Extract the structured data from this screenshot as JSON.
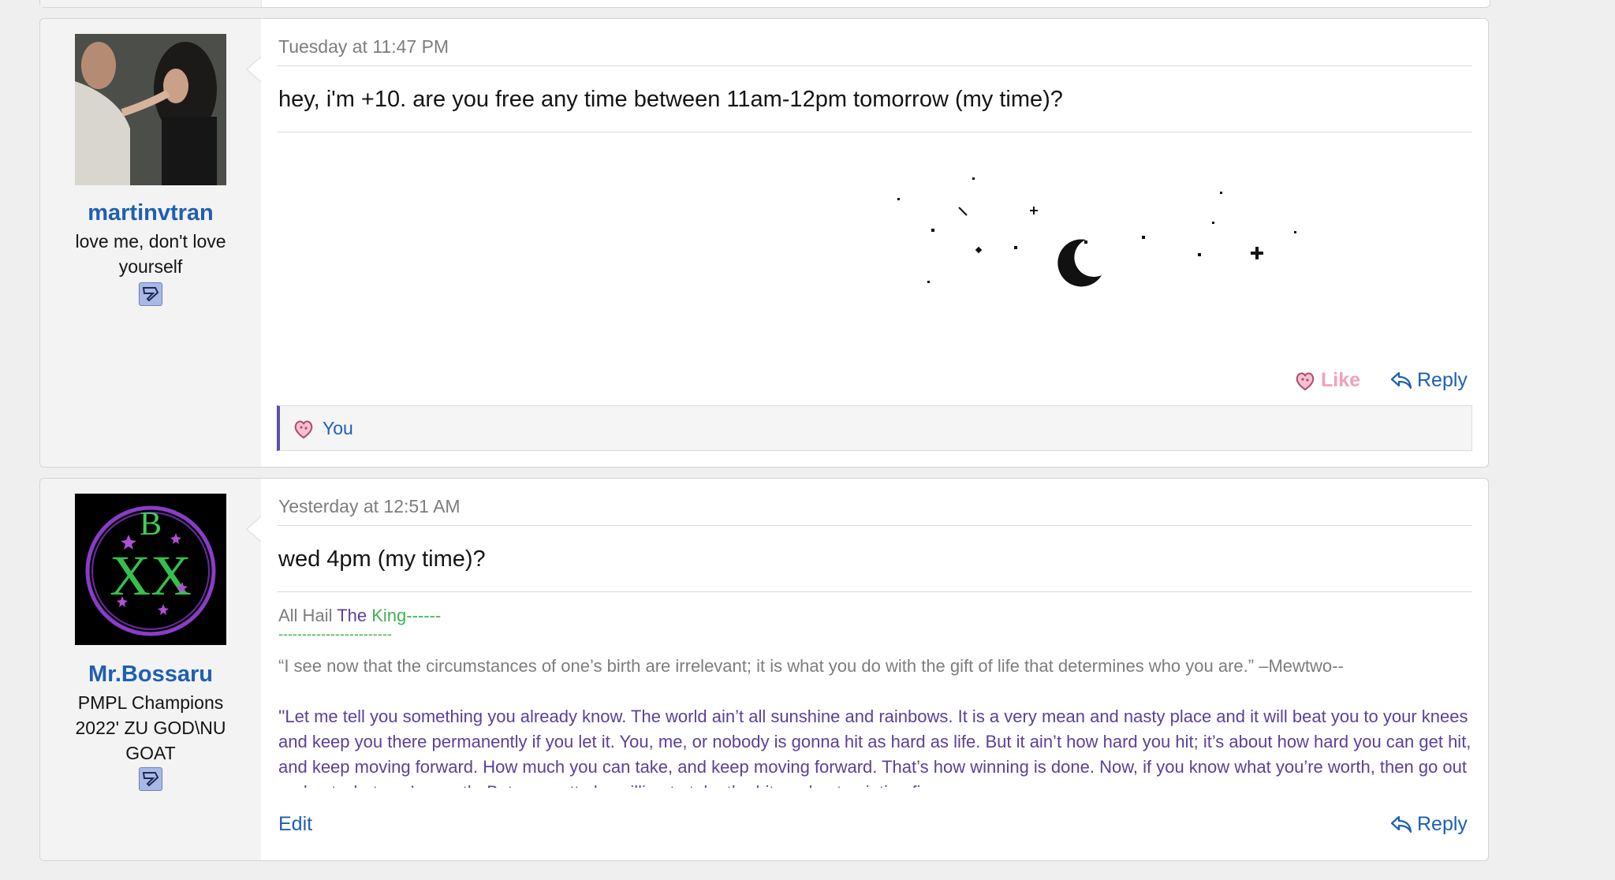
{
  "posts": [
    {
      "username": "martinvtran",
      "user_title": "love me, don't love yourself",
      "datetime": "Tuesday at 11:47 PM",
      "message": "hey, i'm +10. are you free any time between 11am-12pm tomorrow (my time)?",
      "like_label": "Like",
      "reply_label": "Reply",
      "liked_by": "You",
      "avatar_icon": "user-photo-avatar",
      "badge_icon": "user-badge-icon"
    },
    {
      "username": "Mr.Bossaru",
      "user_title": "PMPL Champions 2022' ZU GOD\\NU GOAT",
      "datetime": "Yesterday at 12:51 AM",
      "message": "wed 4pm (my time)?",
      "avatar_letters": "BXX",
      "signature": {
        "part1": "All Hail ",
        "part2": "The ",
        "part3": "King------",
        "dashes": "------------------------",
        "quote1": "“I see now that the circumstances of one’s birth are irrelevant; it is what you do with the gift of life that determines who you are.” –Mewtwo--",
        "quote2": "''Let me tell you something you already know. The world ain’t all sunshine and rainbows. It is a very mean and nasty place and it will beat you to your knees and keep you there permanently if you let it. You, me, or nobody is gonna hit as hard as life. But it ain’t how hard you hit; it’s about how hard you can get hit, and keep moving forward. How much you can take, and keep moving forward. That’s how winning is done. Now, if you know what you’re worth, then go out and get what you’re worth. But you gotta be willing to take the hit, and not pointing fingers"
      },
      "edit_label": "Edit",
      "reply_label": "Reply",
      "badge_icon": "user-badge-icon"
    }
  ],
  "colors": {
    "link": "#1e5fb3",
    "like": "#f49fbd",
    "signature_purple": "#5c3f9b",
    "signature_green": "#3fb34f",
    "muted": "#7d7d7d"
  }
}
